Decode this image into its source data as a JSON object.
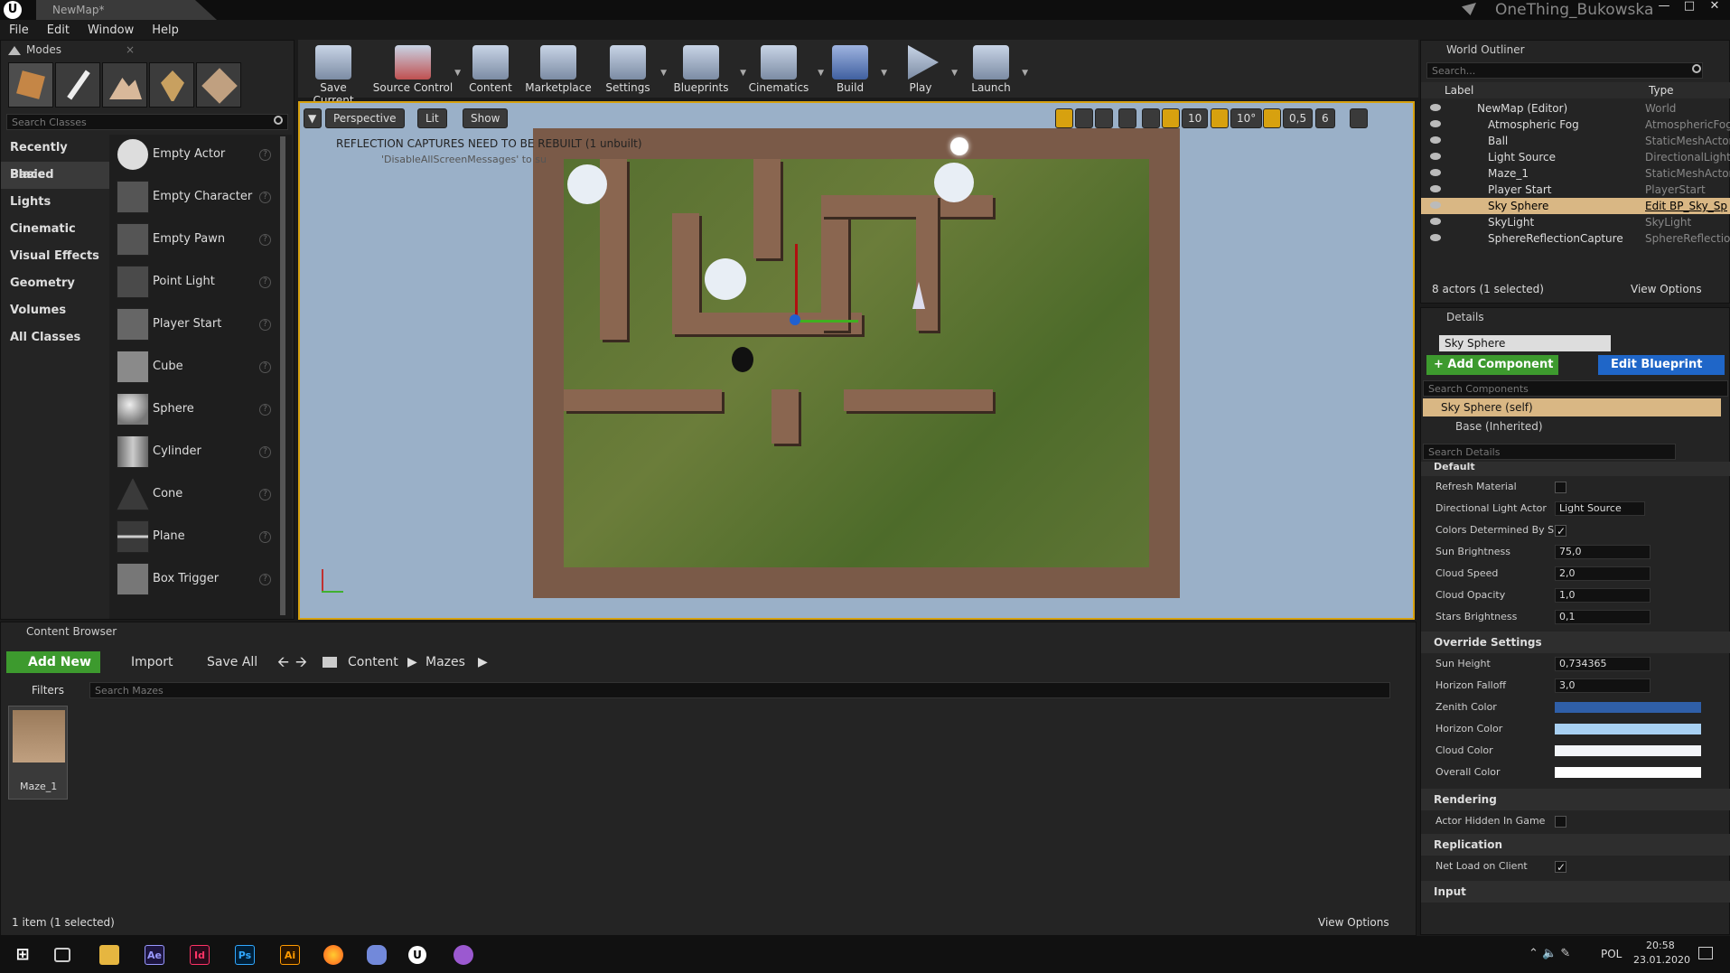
{
  "window": {
    "doc_tab": "NewMap*",
    "project": "OneThing_Bukowska"
  },
  "menu": [
    "File",
    "Edit",
    "Window",
    "Help"
  ],
  "modes": {
    "tab": "Modes",
    "search_placeholder": "Search Classes",
    "categories": [
      "Recently Placed",
      "Basic",
      "Lights",
      "Cinematic",
      "Visual Effects",
      "Geometry",
      "Volumes",
      "All Classes"
    ],
    "selected_category": "Basic",
    "items": [
      "Empty Actor",
      "Empty Character",
      "Empty Pawn",
      "Point Light",
      "Player Start",
      "Cube",
      "Sphere",
      "Cylinder",
      "Cone",
      "Plane",
      "Box Trigger"
    ]
  },
  "toolbar": {
    "buttons": [
      "Save Current",
      "Source Control",
      "Content",
      "Marketplace",
      "Settings",
      "Blueprints",
      "Cinematics",
      "Build",
      "Play",
      "Launch"
    ]
  },
  "viewport": {
    "perspective": "Perspective",
    "lit": "Lit",
    "show": "Show",
    "grid_snap": "10",
    "rot_snap": "10°",
    "scale_snap": "0,5",
    "cam_speed": "6",
    "message": "REFLECTION CAPTURES NEED TO BE REBUILT (1 unbuilt)",
    "message2": "'DisableAllScreenMessages' to su"
  },
  "outliner": {
    "tab": "World Outliner",
    "search_placeholder": "Search...",
    "col_label": "Label",
    "col_type": "Type",
    "rows": [
      {
        "label": "NewMap (Editor)",
        "type": "World"
      },
      {
        "label": "Atmospheric Fog",
        "type": "AtmosphericFog"
      },
      {
        "label": "Ball",
        "type": "StaticMeshActor"
      },
      {
        "label": "Light Source",
        "type": "DirectionalLight"
      },
      {
        "label": "Maze_1",
        "type": "StaticMeshActor"
      },
      {
        "label": "Player Start",
        "type": "PlayerStart"
      },
      {
        "label": "Sky Sphere",
        "type": "Edit BP_Sky_Sp"
      },
      {
        "label": "SkyLight",
        "type": "SkyLight"
      },
      {
        "label": "SphereReflectionCapture",
        "type": "SphereReflection"
      }
    ],
    "selected_row": "Sky Sphere",
    "footer": "8 actors (1 selected)",
    "view_options": "View Options"
  },
  "details": {
    "tab": "Details",
    "name": "Sky Sphere",
    "add_component": "+ Add Component",
    "edit_blueprint": "Edit Blueprint",
    "search_components": "Search Components",
    "self_component": "Sky Sphere (self)",
    "base_inherited": "Base (Inherited)",
    "search_details": "Search Details",
    "default_section": "Default",
    "refresh_material": "Refresh Material",
    "dir_light_actor": "Directional Light Actor",
    "dir_light_value": "Light Source",
    "colors_determined": "Colors Determined By Sun",
    "sun_brightness": "Sun Brightness",
    "sun_brightness_v": "75,0",
    "cloud_speed": "Cloud Speed",
    "cloud_speed_v": "2,0",
    "cloud_opacity": "Cloud Opacity",
    "cloud_opacity_v": "1,0",
    "stars_brightness": "Stars Brightness",
    "stars_brightness_v": "0,1",
    "override_section": "Override Settings",
    "sun_height": "Sun Height",
    "sun_height_v": "0,734365",
    "horizon_falloff": "Horizon Falloff",
    "horizon_falloff_v": "3,0",
    "zenith_color": "Zenith Color",
    "horizon_color": "Horizon Color",
    "cloud_color": "Cloud Color",
    "overall_color": "Overall Color",
    "rendering_section": "Rendering",
    "actor_hidden": "Actor Hidden In Game",
    "replication_section": "Replication",
    "net_load": "Net Load on Client",
    "input_section": "Input",
    "colors": {
      "zenith": "#2f5fa8",
      "horizon": "#a8d0f2",
      "cloud": "#f2f4f8",
      "overall": "#ffffff"
    }
  },
  "content_browser": {
    "tab": "Content Browser",
    "add_new": "Add New",
    "import": "Import",
    "save_all": "Save All",
    "path": [
      "Content",
      "Mazes"
    ],
    "filters": "Filters",
    "search_placeholder": "Search Mazes",
    "asset": "Maze_1",
    "footer": "1 item (1 selected)",
    "view_options": "View Options"
  },
  "taskbar": {
    "lang": "POL",
    "time": "20:58",
    "date": "23.01.2020",
    "apps": [
      "Ae",
      "Id",
      "Ps",
      "Ai"
    ]
  }
}
